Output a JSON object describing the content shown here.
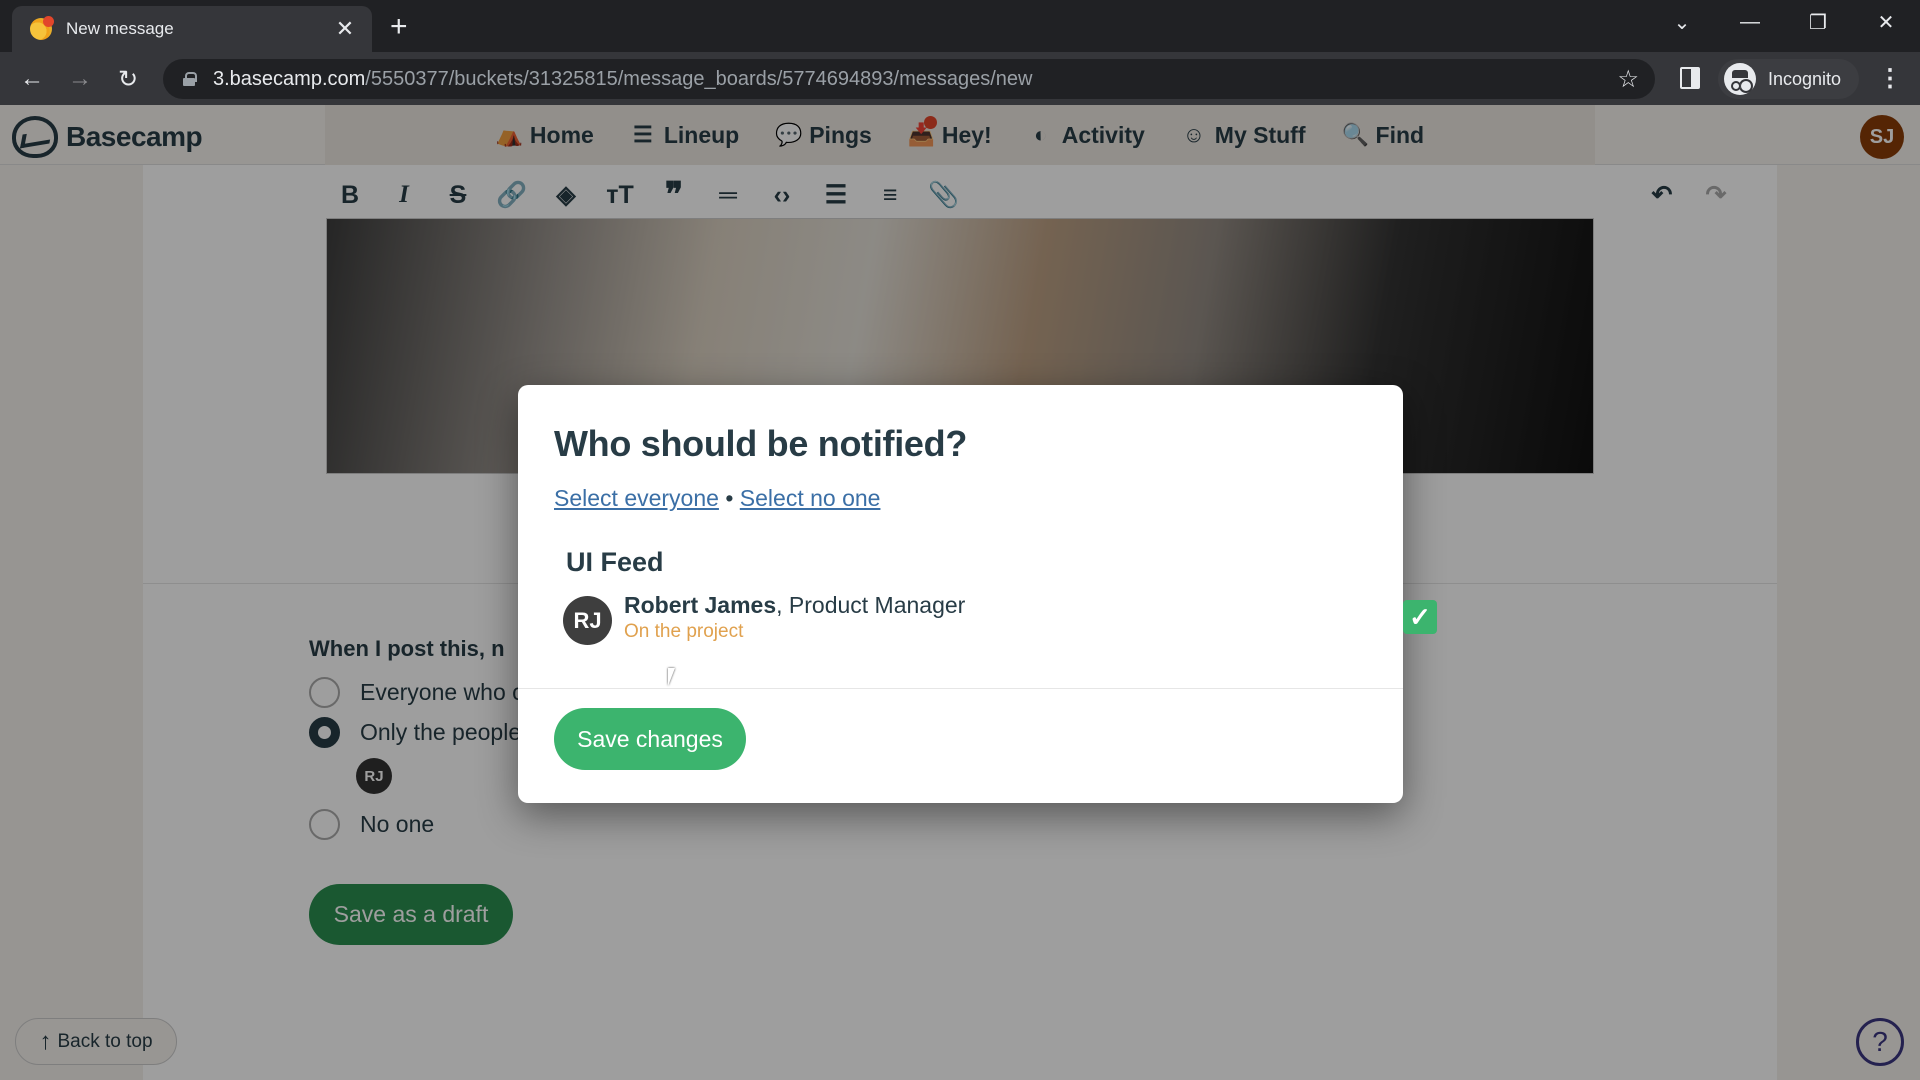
{
  "browser": {
    "tab_title": "New message",
    "url_host": "3.basecamp.com",
    "url_path": "/5550377/buckets/31325815/message_boards/5774694893/messages/new",
    "profile_label": "Incognito"
  },
  "nav": {
    "logo_text": "Basecamp",
    "items": [
      {
        "label": "Home",
        "icon": "home-icon"
      },
      {
        "label": "Lineup",
        "icon": "lineup-icon"
      },
      {
        "label": "Pings",
        "icon": "pings-icon"
      },
      {
        "label": "Hey!",
        "icon": "hey-inbox-icon",
        "has_notification": true
      },
      {
        "label": "Activity",
        "icon": "activity-icon"
      },
      {
        "label": "My Stuff",
        "icon": "smiley-icon"
      },
      {
        "label": "Find",
        "icon": "search-icon"
      }
    ],
    "avatar_initials": "SJ",
    "avatar_color": "#8a3c08"
  },
  "toolbar": {
    "buttons": [
      "bold",
      "italic",
      "strikethrough",
      "link",
      "color",
      "heading",
      "quote",
      "divider",
      "code",
      "bulleted-list",
      "numbered-list",
      "attachment"
    ],
    "undo": "undo",
    "redo": "redo"
  },
  "notify_section": {
    "heading": "When I post this, n",
    "options": [
      {
        "label": "Everyone who c",
        "checked": false
      },
      {
        "label": "Only the people",
        "checked": true
      },
      {
        "label": "No one",
        "checked": false
      }
    ],
    "selected_avatar": "RJ",
    "draft_button": "Save as a draft"
  },
  "footer": {
    "back_to_top": "Back to top",
    "help": "?"
  },
  "modal": {
    "title": "Who should be notified?",
    "select_everyone": "Select everyone",
    "separator": "•",
    "select_no_one": "Select no one",
    "group_title": "UI Feed",
    "people": [
      {
        "initials": "RJ",
        "name": "Robert James",
        "role": ", Product Manager",
        "status": "On the project",
        "checked": true
      }
    ],
    "save_button": "Save changes"
  },
  "colors": {
    "accent_green": "#3cb46e",
    "link_blue": "#3b6fa6",
    "status_orange": "#e0a14e",
    "text_dark": "#283c46"
  }
}
